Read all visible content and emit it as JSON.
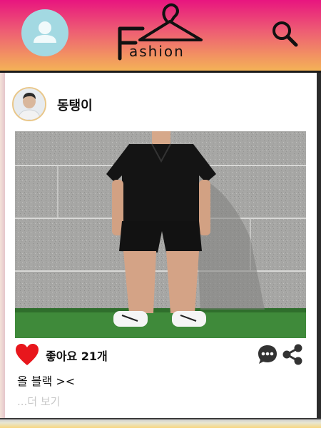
{
  "header": {
    "logo_text": "ashion",
    "logo_letter": "F",
    "profile_icon": "user-icon",
    "search_icon": "search-icon"
  },
  "post": {
    "username": "동탱이",
    "likes_label": "좋아요 21개",
    "caption": "올 블랙 ><",
    "more_label": "...더 보기",
    "like_icon": "heart-icon",
    "comment_icon": "comment-icon",
    "share_icon": "share-icon"
  },
  "colors": {
    "header_top": "#e8157f",
    "header_bottom": "#f4b257",
    "heart": "#e8161c",
    "profile_circle": "#a3d9e2"
  }
}
